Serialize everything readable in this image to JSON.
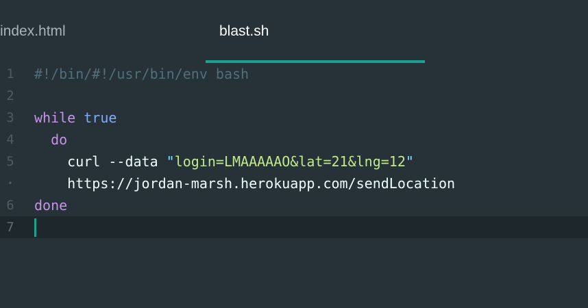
{
  "tabs": [
    {
      "label": "index.html",
      "active": false
    },
    {
      "label": "blast.sh",
      "active": true
    }
  ],
  "colors": {
    "background": "#263238",
    "accent": "#1aa290",
    "keyword": "#c792ea",
    "builtin": "#82aaff",
    "string": "#c3e88d",
    "comment": "#546e7a",
    "gutter": "#4b5c65"
  },
  "editor": {
    "gutter": [
      "1",
      "2",
      "3",
      "4",
      "5",
      "•",
      "6",
      "7"
    ],
    "lines": {
      "l1_comment": "#!/bin/#!/usr/bin/env bash",
      "l3_keyword": "while",
      "l3_builtin": "true",
      "l4_keyword": "do",
      "l5_cmd": "curl --data ",
      "l5_quote_open": "\"",
      "l5_string": "login=LMAAAAAO&lat=21&lng=12",
      "l5_quote_close": "\"",
      "l5b_url": "https://jordan-marsh.herokuapp.com/sendLocation",
      "l6_keyword": "done"
    }
  }
}
